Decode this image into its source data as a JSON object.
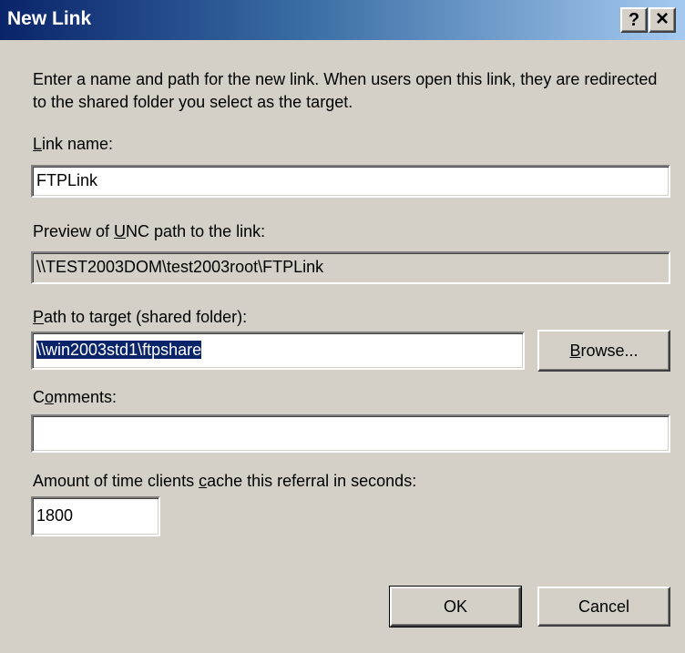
{
  "window": {
    "title": "New Link",
    "help_glyph": "?",
    "close_glyph": "×"
  },
  "description": "Enter a name and path for the new link. When users open this link, they are redirected to the shared folder you select as the target.",
  "link_name": {
    "label_mnemonic": "L",
    "label_rest": "ink name:",
    "value": "FTPLink"
  },
  "unc_preview": {
    "label_pre": "Preview of ",
    "label_mnemonic": "U",
    "label_rest": "NC path to the link:",
    "value": "\\\\TEST2003DOM\\test2003root\\FTPLink"
  },
  "target_path": {
    "label_mnemonic": "P",
    "label_rest": "ath to target (shared folder):",
    "value": "\\\\win2003std1\\ftpshare",
    "browse_mnemonic": "B",
    "browse_rest": "rowse..."
  },
  "comments": {
    "label_pre": "C",
    "label_mnemonic": "o",
    "label_rest": "mments:",
    "value": ""
  },
  "cache_time": {
    "label_pre": "Amount of time clients ",
    "label_mnemonic": "c",
    "label_rest": "ache this referral in seconds:",
    "value": "1800"
  },
  "buttons": {
    "ok_label": "OK",
    "cancel_label": "Cancel"
  }
}
